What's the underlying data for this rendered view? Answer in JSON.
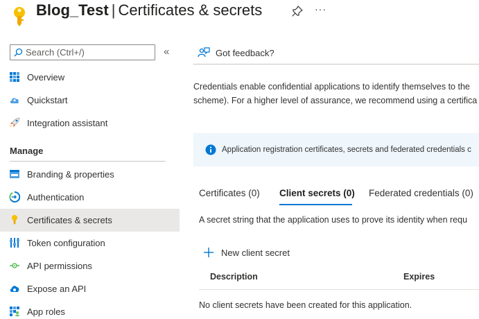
{
  "header": {
    "app_name": "Blog_Test",
    "separator": "|",
    "page_title": "Certificates & secrets",
    "more": "···"
  },
  "sidebar": {
    "search_placeholder": "Search (Ctrl+/)",
    "collapse": "«",
    "items_top": [
      {
        "label": "Overview",
        "icon": "overview-grid-icon"
      },
      {
        "label": "Quickstart",
        "icon": "cloud-icon"
      },
      {
        "label": "Integration assistant",
        "icon": "rocket-icon"
      }
    ],
    "section_title": "Manage",
    "items_manage": [
      {
        "label": "Branding & properties",
        "icon": "branding-icon"
      },
      {
        "label": "Authentication",
        "icon": "authentication-icon"
      },
      {
        "label": "Certificates & secrets",
        "icon": "key-icon",
        "active": true
      },
      {
        "label": "Token configuration",
        "icon": "token-config-icon"
      },
      {
        "label": "API permissions",
        "icon": "api-permissions-icon"
      },
      {
        "label": "Expose an API",
        "icon": "expose-api-icon"
      },
      {
        "label": "App roles",
        "icon": "app-roles-icon"
      }
    ]
  },
  "main": {
    "feedback_label": "Got feedback?",
    "description_line1": "Credentials enable confidential applications to identify themselves to the",
    "description_line2": "scheme). For a higher level of assurance, we recommend using a certifica",
    "info_text": "Application registration certificates, secrets and federated credentials c",
    "tabs": [
      {
        "label": "Certificates (0)"
      },
      {
        "label": "Client secrets (0)",
        "active": true
      },
      {
        "label": "Federated credentials (0)"
      }
    ],
    "tab_description": "A secret string that the application uses to prove its identity when requ",
    "new_secret_label": "New client secret",
    "table": {
      "columns": [
        "Description",
        "Expires"
      ],
      "empty_message": "No client secrets have been created for this application."
    }
  },
  "colors": {
    "accent": "#0078d4",
    "key_yellow": "#f8c000",
    "active_nav_bg": "#e9e8e7",
    "info_bg": "#eff6fc"
  }
}
